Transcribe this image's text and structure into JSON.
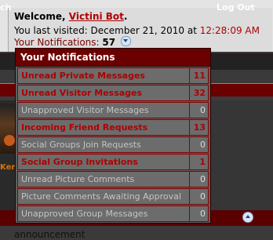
{
  "welcome": {
    "prefix": "Welcome, ",
    "username": "Victini Bot",
    "suffix": ".",
    "last_visited_label": "You last visited: December 21, 2010 at ",
    "last_visited_time": "12:28:09 AM",
    "notifications_label": "Your Notifications:",
    "notifications_count": "57"
  },
  "navbar": {
    "left_fragment": "ch",
    "right_item": "Log Out"
  },
  "background": {
    "avatar_text": "Kenn",
    "bottom_text": "announcement"
  },
  "popup": {
    "title": "Your Notifications",
    "items": [
      {
        "label": "Unread Private Messages",
        "count": "11"
      },
      {
        "label": "Unread Visitor Messages",
        "count": "32"
      },
      {
        "label": "Unapproved Visitor Messages",
        "count": "0"
      },
      {
        "label": "Incoming Friend Requests",
        "count": "13"
      },
      {
        "label": "Social Groups Join Requests",
        "count": "0"
      },
      {
        "label": "Social Group Invitations",
        "count": "1"
      },
      {
        "label": "Unread Picture Comments",
        "count": "0"
      },
      {
        "label": "Picture Comments Awaiting Approval",
        "count": "0"
      },
      {
        "label": "Unapproved Group Messages",
        "count": "0"
      }
    ]
  },
  "colors": {
    "accent": "#6b0000",
    "link": "#b00000",
    "popup_bg": "#5e5e5e"
  }
}
